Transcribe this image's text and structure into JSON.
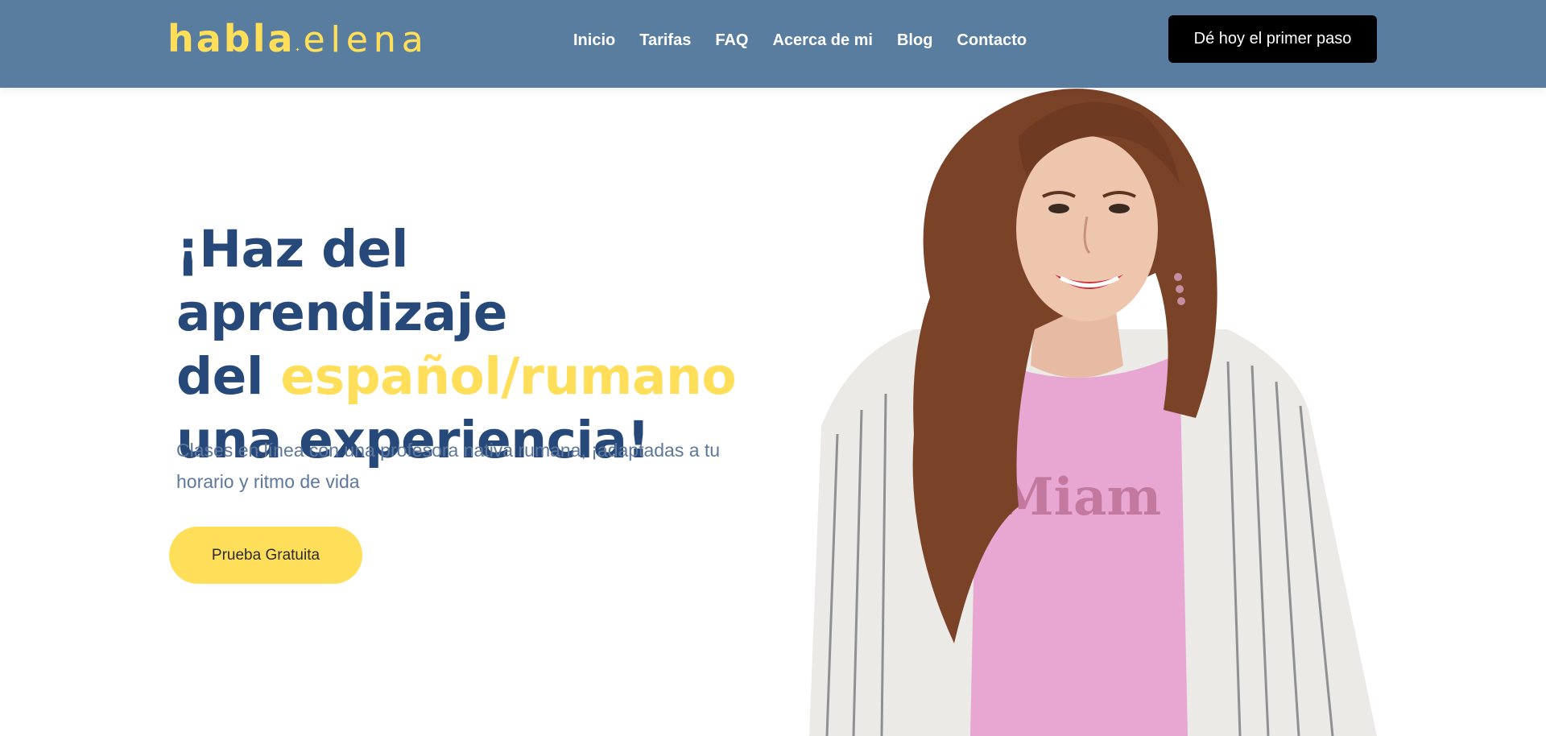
{
  "header": {
    "logo": {
      "part1": "habla",
      "part2": "elena"
    },
    "nav": [
      "Inicio",
      "Tarifas",
      "FAQ",
      "Acerca de mi",
      "Blog",
      "Contacto"
    ],
    "cta_label": "Dé hoy el primer paso"
  },
  "hero": {
    "title_line1": "¡Haz del aprendizaje",
    "title_line2_prefix": "del ",
    "title_highlight": "español/rumano",
    "title_line3": "una experiencia!",
    "subtitle": "Clases en línea con una profesora nativa rumana, ¡adaptadas a tu horario y ritmo de vida",
    "cta_label": "Prueba Gratuita",
    "portrait_shirt_text": "Miam"
  },
  "colors": {
    "header_bg": "#587d9f",
    "brand_yellow": "#ffde59",
    "title_blue": "#26497a",
    "subtitle_gray_blue": "#5e789c",
    "top_cta_bg": "#000000"
  }
}
